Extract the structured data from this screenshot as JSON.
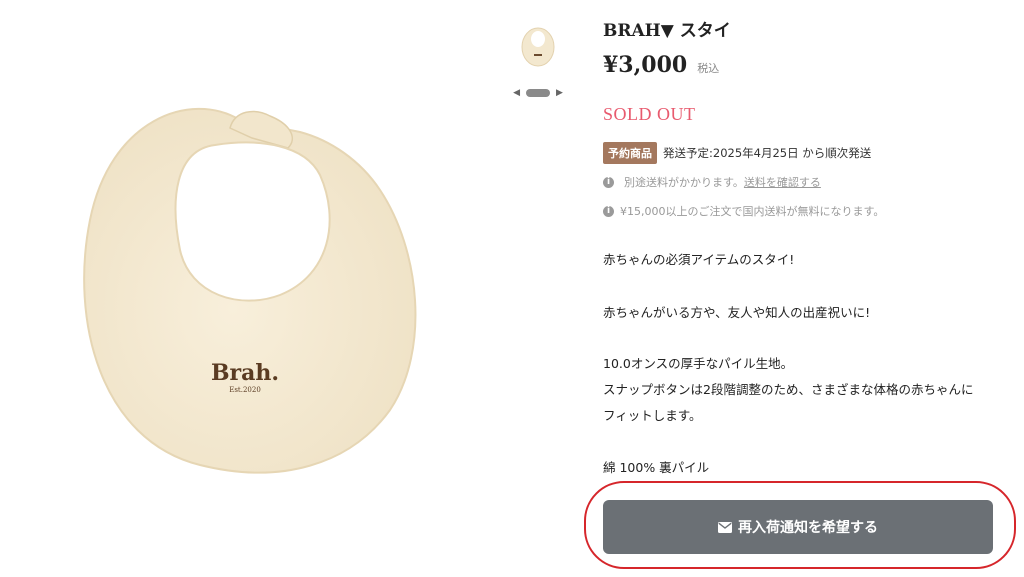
{
  "product": {
    "title": "BRAH▼ スタイ",
    "price": "¥3,000",
    "tax_label": "税込",
    "status": "SOLD OUT",
    "image_logo": "Brah.",
    "image_logo_sub": "Est.2020"
  },
  "preorder": {
    "badge": "予約商品",
    "shipping_text": "発送予定:2025年4月25日 から順次発送"
  },
  "notices": {
    "shipping_fee_text": "別途送料がかかります。",
    "shipping_fee_link": "送料を確認する",
    "free_shipping_text": "¥15,000以上のご注文で国内送料が無料になります。"
  },
  "description": [
    "赤ちゃんの必須アイテムのスタイ!",
    "赤ちゃんがいる方や、友人や知人の出産祝いに!",
    "10.0オンスの厚手なパイル生地。",
    "スナップボタンは2段階調整のため、さまざまな体格の赤ちゃんに",
    "フィットします。",
    "綿 100% 裏パイル"
  ],
  "restock_button": {
    "label": "再入荷通知を希望する",
    "icon": "mail-icon"
  },
  "colors": {
    "soldout": "#e85a6e",
    "badge": "#a4785e",
    "button": "#6b7075",
    "annotation": "#d6262b",
    "bib": "#f6ecd6"
  }
}
